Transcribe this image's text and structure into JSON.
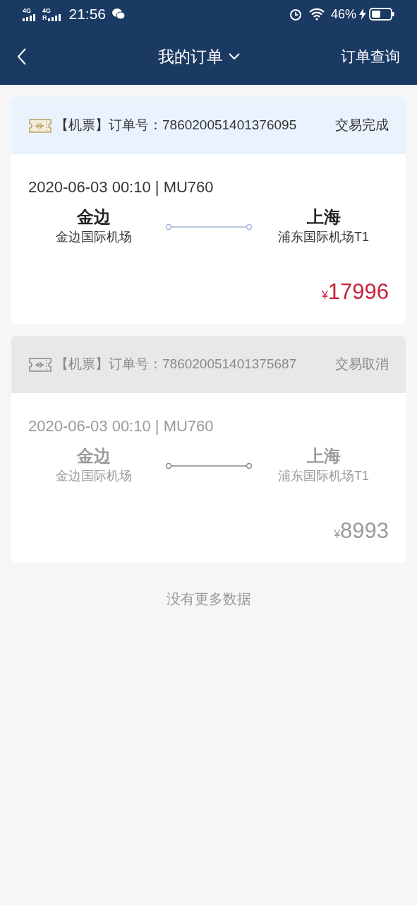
{
  "status_bar": {
    "network_1": "4G",
    "network_2": "4G",
    "roaming": "R",
    "time": "21:56",
    "battery": "46%"
  },
  "nav": {
    "title": "我的订单",
    "action": "订单查询"
  },
  "orders": [
    {
      "cancelled": false,
      "type_label": "【机票】订单号：",
      "order_no": "786020051401376095",
      "status": "交易完成",
      "datetime": "2020-06-03 00:10 | MU760",
      "from_city": "金边",
      "from_airport": "金边国际机场",
      "to_city": "上海",
      "to_airport": "浦东国际机场T1",
      "currency": "¥",
      "price": "17996"
    },
    {
      "cancelled": true,
      "type_label": "【机票】订单号：",
      "order_no": "786020051401375687",
      "status": "交易取消",
      "datetime": "2020-06-03 00:10 | MU760",
      "from_city": "金边",
      "from_airport": "金边国际机场",
      "to_city": "上海",
      "to_airport": "浦东国际机场T1",
      "currency": "¥",
      "price": "8993"
    }
  ],
  "footer_note": "没有更多数据"
}
